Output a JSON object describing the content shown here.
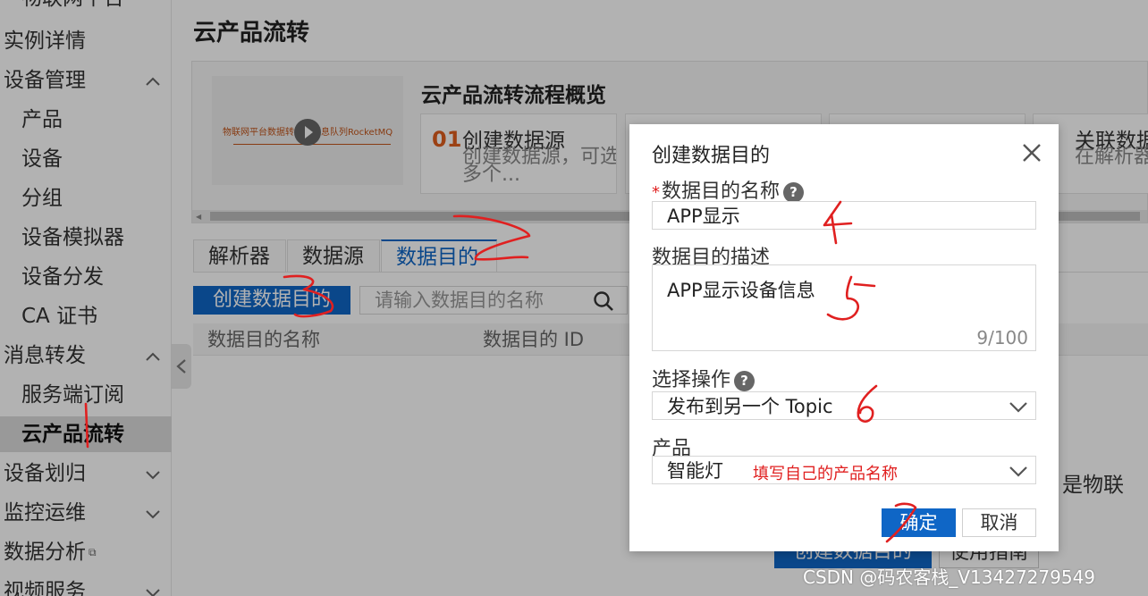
{
  "sidebar": {
    "partial_top": "物联网平台",
    "instance_details": "实例详情",
    "device_management": "设备管理",
    "products": "产品",
    "devices": "设备",
    "groups": "分组",
    "device_simulator": "设备模拟器",
    "device_distribution": "设备分发",
    "ca_certificate": "CA 证书",
    "message_forwarding": "消息转发",
    "server_subscription": "服务端订阅",
    "cloud_product_forwarding": "云产品流转",
    "device_assignment": "设备划归",
    "monitoring_ops": "监控运维",
    "data_analysis": "数据分析",
    "video_service": "视频服务"
  },
  "main": {
    "page_title": "云产品流转",
    "video_caption": "物联网平台数据转发到消息队列RocketMQ",
    "flow_title": "云产品流转流程概览",
    "step1": {
      "num": "01",
      "title": "创建数据源",
      "desc": "创建数据源，可选择多个..."
    },
    "step4": {
      "title": "关联数据",
      "desc": "在解析器关联数据源"
    },
    "tabs": {
      "parser": "解析器",
      "data_source": "数据源",
      "data_destination": "数据目的"
    },
    "create_button": "创建数据目的",
    "search_placeholder": "请输入数据目的名称",
    "table_headers": {
      "name": "数据目的名称",
      "id": "数据目的 ID"
    },
    "empty_text": "是物联\n产品。",
    "empty_create_button": "创建数据目的",
    "empty_guide_button": "使用指南"
  },
  "dialog": {
    "title": "创建数据目的",
    "name_label": "数据目的名称",
    "name_value": "APP显示",
    "desc_label": "数据目的描述",
    "desc_value": "APP显示设备信息",
    "char_count": "9/100",
    "operation_label": "选择操作",
    "operation_value": "发布到另一个 Topic",
    "product_label": "产品",
    "product_value": "智能灯",
    "product_note": "填写自己的产品名称",
    "ok_button": "确定",
    "cancel_button": "取消"
  },
  "watermark": "CSDN @码农客栈_V13427279549",
  "colors": {
    "primary": "#0f66c6",
    "annotation": "#e02020",
    "step_number": "#e05e1e"
  }
}
